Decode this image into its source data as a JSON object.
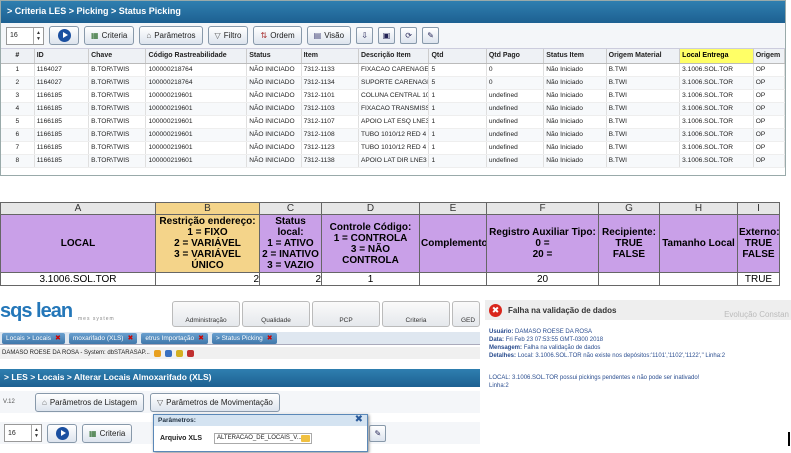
{
  "top": {
    "title": "> Criteria LES > Picking > Status Picking",
    "spin_value": "16",
    "buttons": {
      "criteria": "Criteria",
      "parametros": "Parâmetros",
      "filtro": "Filtro",
      "ordem": "Ordem",
      "visao": "Visão"
    },
    "columns": [
      "#",
      "ID",
      "Chave",
      "Código Rastreabilidade",
      "Status",
      "Item",
      "Descrição Item",
      "Qtd",
      "Qtd Pago",
      "Status Item",
      "Origem Material",
      "Local Entrega",
      "Origem"
    ],
    "rows": [
      [
        "1",
        "1164027",
        "B.TOR\\TWIS",
        "100000218764",
        "NÃO INICIADO",
        "7312-1133",
        "FIXACAO CARENAGEI",
        "5",
        "0",
        "Não Iniciado",
        "B.TWI",
        "3.1006.SOL.TOR",
        "OP"
      ],
      [
        "2",
        "1164027",
        "B.TOR\\TWIS",
        "100000218764",
        "NÃO INICIADO",
        "7312-1134",
        "SUPORTE CARENAGEI",
        "5",
        "0",
        "Não Iniciado",
        "B.TWI",
        "3.1006.SOL.TOR",
        "OP"
      ],
      [
        "3",
        "1166185",
        "B.TOR\\TWIS",
        "100000219601",
        "NÃO INICIADO",
        "7312-1101",
        "COLUNA CENTRAL 10",
        "1",
        "undefined",
        "Não Iniciado",
        "B.TWI",
        "3.1006.SOL.TOR",
        "OP"
      ],
      [
        "4",
        "1166185",
        "B.TOR\\TWIS",
        "100000219601",
        "NÃO INICIADO",
        "7312-1103",
        "FIXACAO TRANSMISS",
        "1",
        "undefined",
        "Não Iniciado",
        "B.TWI",
        "3.1006.SOL.TOR",
        "OP"
      ],
      [
        "5",
        "1166185",
        "B.TOR\\TWIS",
        "100000219601",
        "NÃO INICIADO",
        "7312-1107",
        "APOIO LAT ESQ LNE3",
        "1",
        "undefined",
        "Não Iniciado",
        "B.TWI",
        "3.1006.SOL.TOR",
        "OP"
      ],
      [
        "6",
        "1166185",
        "B.TOR\\TWIS",
        "100000219601",
        "NÃO INICIADO",
        "7312-1108",
        "TUBO 1010/12 RED 4",
        "1",
        "undefined",
        "Não Iniciado",
        "B.TWI",
        "3.1006.SOL.TOR",
        "OP"
      ],
      [
        "7",
        "1166185",
        "B.TOR\\TWIS",
        "100000219601",
        "NÃO INICIADO",
        "7312-1123",
        "TUBO 1010/12 RED 4",
        "1",
        "undefined",
        "Não Iniciado",
        "B.TWI",
        "3.1006.SOL.TOR",
        "OP"
      ],
      [
        "8",
        "1166185",
        "B.TOR\\TWIS",
        "100000219601",
        "NÃO INICIADO",
        "7312-1138",
        "APOIO LAT DIR LNE3",
        "1",
        "undefined",
        "Não Iniciado",
        "B.TWI",
        "3.1006.SOL.TOR",
        "OP"
      ]
    ]
  },
  "sheet": {
    "cols": [
      "A",
      "B",
      "C",
      "D",
      "E",
      "F",
      "G",
      "H",
      "I"
    ],
    "headers": [
      "LOCAL",
      "Restrição endereço:\n1 = FIXO\n2 = VARIÁVEL\n3 = VARIÁVEL ÚNICO",
      "Status local:\n1 = ATIVO\n2 = INATIVO\n3 = VAZIO",
      "Controle Código:\n1 = CONTROLA\n3 = NÃO CONTROLA",
      "Complemento",
      "Registro Auxiliar Tipo:\n0 =\n20 =",
      "Recipiente:\nTRUE\nFALSE",
      "Tamanho Local",
      "Externo:\nTRUE\nFALSE"
    ],
    "values": [
      "3.1006.SOL.TOR",
      "2",
      "2",
      "1",
      "",
      "20",
      "",
      "",
      "TRUE"
    ]
  },
  "bottom": {
    "brand": "sqs lean",
    "brand_sub": "mes system",
    "modules": [
      "Administração",
      "Qualidade",
      "PCP",
      "Criteria",
      "GED"
    ],
    "tabs": [
      "Locais > Locais",
      "moxarifado (XLS)",
      "etrus Importação",
      "> Status Picking"
    ],
    "user_line": "DAMASO ROESE DA ROSA - System: dbSTARASAP...",
    "title": "> LES > Locais > Alterar Locais Almoxarifado (XLS)",
    "version": "V.12",
    "param_listagem": "Parâmetros de Listagem",
    "param_movimentacao": "Parâmetros de Movimentação",
    "spin_value": "16",
    "criteria": "Criteria",
    "popup_title": "Parâmetros:",
    "popup_label": "Arquivo XLS",
    "popup_value": "ALTERACAO_DE_LOCAIS_V..."
  },
  "error": {
    "title": "Falha na validação de dados",
    "watermark": "Evolução Constan",
    "usuario_label": "Usuário:",
    "usuario": "DAMASO ROESE DA ROSA",
    "data_label": "Data:",
    "data": "Fri Feb 23 07:53:55 GMT-0300 2018",
    "mensagem_label": "Mensagem:",
    "mensagem": "Falha na validação de dados",
    "detalhes_label": "Detalhes:",
    "detalhes": "Local: 3.1006.SOL.TOR não existe nos depósitos:'1101','1102','1122',\" Linha:2",
    "local_msg": "LOCAL: 3.1006.SOL.TOR possui pickings pendentes e não pode ser inativado!",
    "linha": "Linha:2"
  }
}
